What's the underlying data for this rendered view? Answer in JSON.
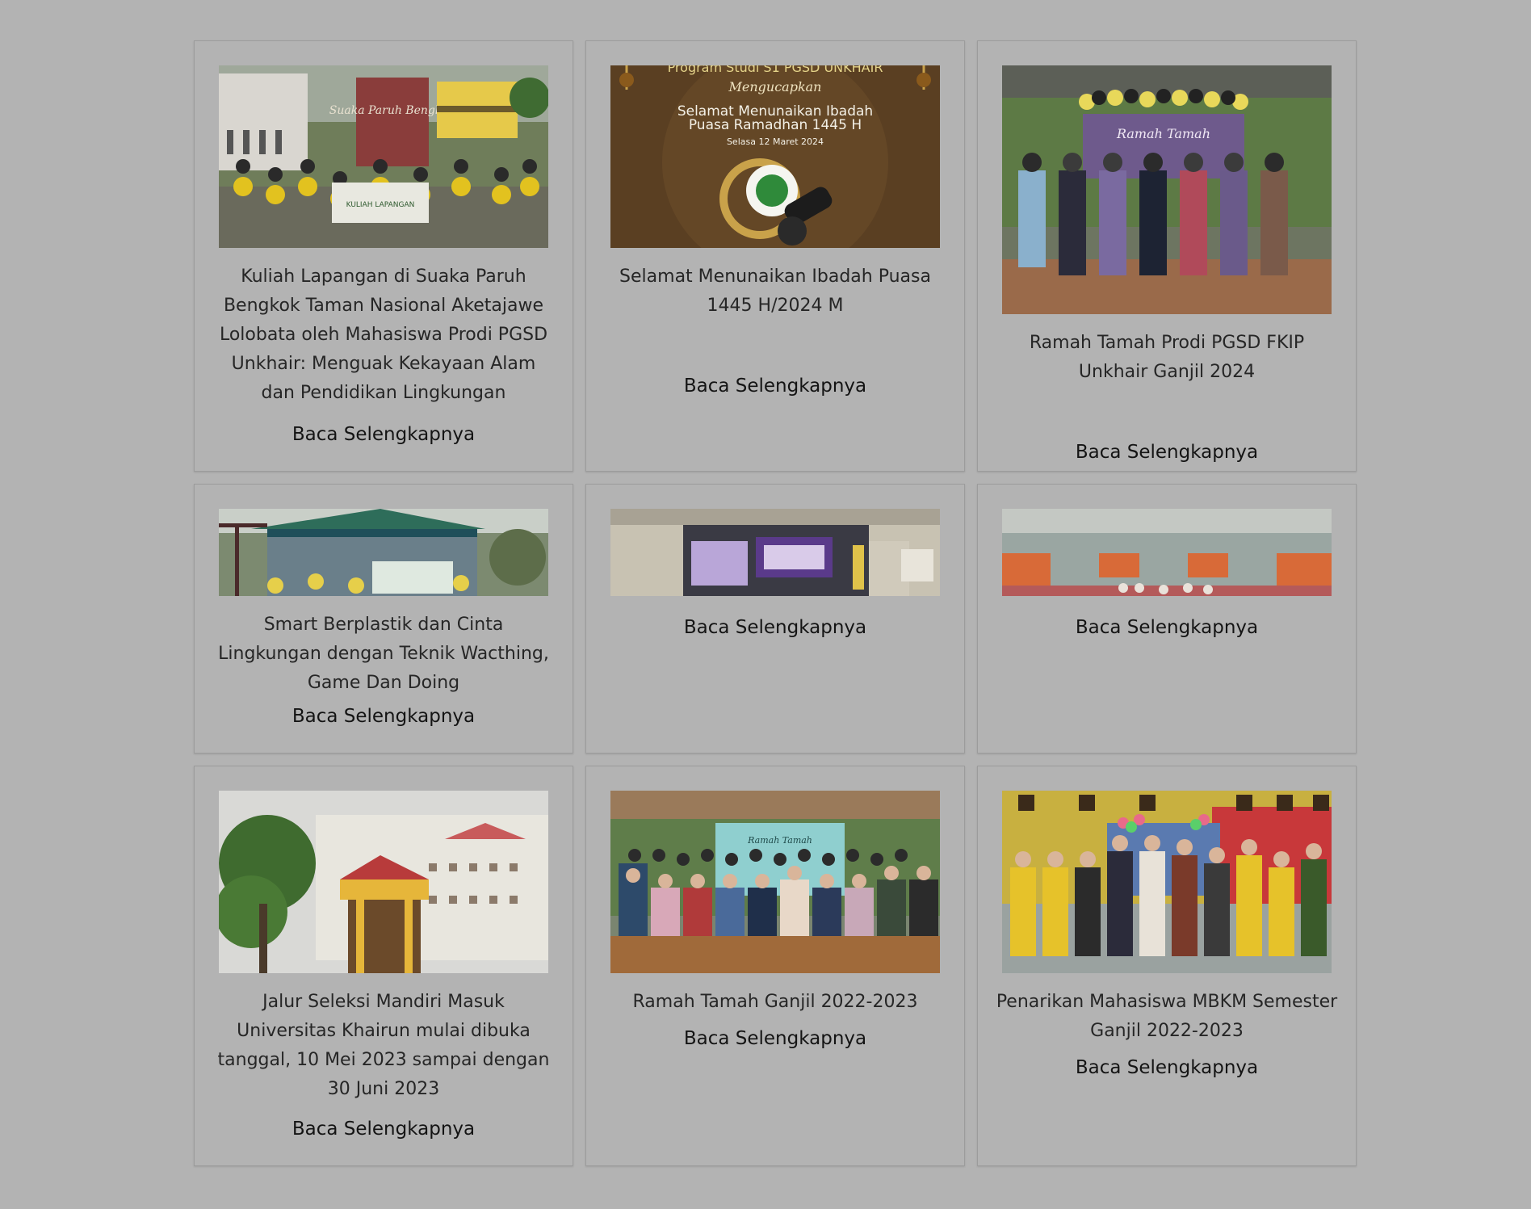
{
  "posts": [
    {
      "title": "Kuliah Lapangan di Suaka Paruh Bengkok Taman Nasional Aketajawe Lolobata oleh Mahasiswa Prodi PGSD Unkhair: Menguak Kekayaan Alam dan Pendidikan Lingkungan",
      "link": "Baca Selengkapnya",
      "sign_text": "Suaka Paruh Bengkok",
      "banner_text": "KULIAH LAPANGAN"
    },
    {
      "title": "Selamat Menunaikan Ibadah Puasa 1445 H/2024 M",
      "link": "Baca Selengkapnya",
      "top_text": "Program Studi S1 PGSD UNKHAIR",
      "script_text": "Mengucapkan",
      "greeting_line1": "Selamat Menunaikan Ibadah",
      "greeting_line2": "Puasa Ramadhan 1445 H",
      "date_text": "Selasa 12 Maret 2024"
    },
    {
      "title": "Ramah Tamah Prodi PGSD FKIP Unkhair Ganjil 2024",
      "link": "Baca Selengkapnya",
      "banner_text": "Ramah Tamah"
    },
    {
      "title": "Smart Berplastik dan Cinta Lingkungan dengan Teknik Wacthing, Game Dan Doing",
      "link": "Baca Selengkapnya"
    },
    {
      "title": "",
      "link": "Baca Selengkapnya"
    },
    {
      "title": "",
      "link": "Baca Selengkapnya"
    },
    {
      "title": "Jalur Seleksi Mandiri Masuk Universitas Khairun mulai dibuka tanggal, 10 Mei 2023 sampai dengan 30 Juni 2023",
      "link": "Baca Selengkapnya"
    },
    {
      "title": "Ramah Tamah Ganjil 2022-2023",
      "link": "Baca Selengkapnya",
      "banner_text": "Ramah Tamah"
    },
    {
      "title": "Penarikan Mahasiswa MBKM Semester Ganjil 2022-2023",
      "link": "Baca Selengkapnya"
    }
  ],
  "colors": {
    "page_bg": "#b3b3b3",
    "card_border": "#9c9c9c",
    "text": "#262626"
  }
}
